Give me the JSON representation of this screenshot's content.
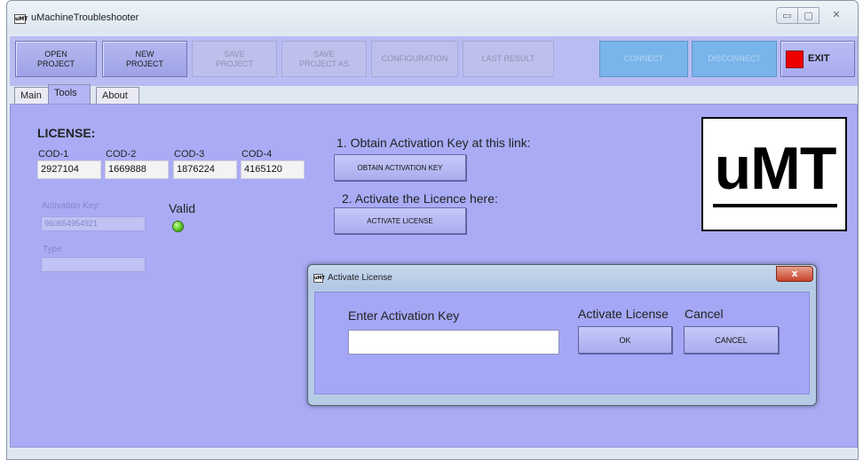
{
  "window": {
    "title": "uMachineTroubleshooter",
    "icon_text": "uMT",
    "controls": {
      "minimize": "▭",
      "maximize": "▢",
      "close": "✕"
    }
  },
  "toolbar": {
    "open_project": "OPEN\nPROJECT",
    "new_project": "NEW\nPROJECT",
    "save_project": "SAVE\nPROJECT",
    "save_project_as": "SAVE\nPROJECT AS",
    "configuration": "CONFIGURATION",
    "last_result": "LAST RESULT",
    "connect": "CONNECT",
    "disconnect": "DISCONNECT",
    "exit": "EXIT"
  },
  "tabs": [
    "Main",
    "Tools",
    "About"
  ],
  "active_tab": "Tools",
  "license": {
    "title": "LICENSE:",
    "codes": [
      {
        "label": "COD-1",
        "value": "2927104"
      },
      {
        "label": "COD-2",
        "value": "1669888"
      },
      {
        "label": "COD-3",
        "value": "1876224"
      },
      {
        "label": "COD-4",
        "value": "4165120"
      }
    ],
    "activation_key_label": "Activation Key:",
    "activation_key_value": "960654954921",
    "type_label": "Type",
    "type_value": "",
    "status_label": "Valid",
    "status_color": "#4dc21b"
  },
  "steps": {
    "step1_label": "1. Obtain Activation Key at this link:",
    "step1_button": "OBTAIN ACTIVATION KEY",
    "step2_label": "2. Activate the Licence here:",
    "step2_button": "ACTIVATE LICENSE"
  },
  "logo": {
    "text": "uMT"
  },
  "dialog": {
    "title": "Activate License",
    "close": "x",
    "key_label": "Enter Activation Key",
    "key_value": "",
    "activate_label": "Activate License",
    "cancel_label": "Cancel",
    "ok_button": "OK",
    "cancel_button": "CANCEL"
  },
  "colors": {
    "panel": "#a9acf5",
    "toolbar": "#b9bcf3",
    "connect_blue": "#79b4ea",
    "exit_red": "#ee0000"
  }
}
